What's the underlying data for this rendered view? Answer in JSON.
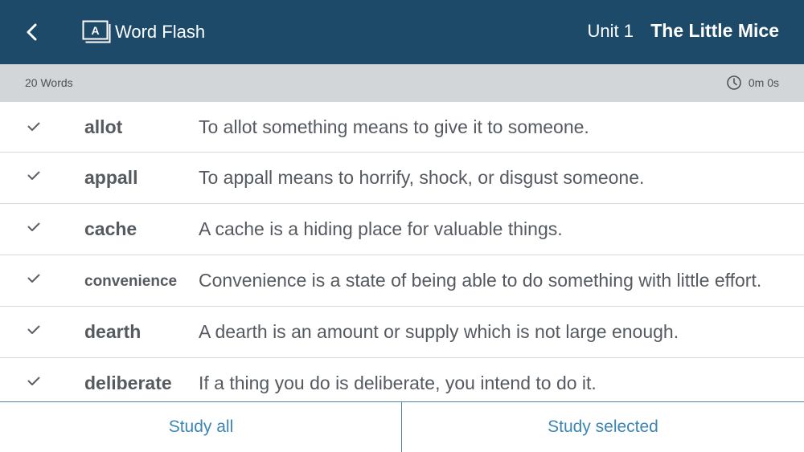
{
  "header": {
    "app_title": "Word Flash",
    "logo_letter": "A",
    "unit": "Unit 1",
    "story_title": "The Little Mice"
  },
  "subbar": {
    "word_count": "20 Words",
    "timer": "0m 0s"
  },
  "words": [
    {
      "word": "allot",
      "definition": "To allot something means to give it to someone."
    },
    {
      "word": "appall",
      "definition": "To appall means to horrify, shock, or disgust someone."
    },
    {
      "word": "cache",
      "definition": "A cache is a hiding place for valuable things."
    },
    {
      "word": "convenience",
      "definition": "Convenience is a state of being able to do something with little effort."
    },
    {
      "word": "dearth",
      "definition": "A dearth is an amount or supply which is not large enough."
    },
    {
      "word": "deliberate",
      "definition": "If a thing you do is deliberate, you intend to do it."
    }
  ],
  "footer": {
    "study_all": "Study all",
    "study_selected": "Study selected"
  },
  "colors": {
    "header_bg": "#1d4a69",
    "subbar_bg": "#d3d6d8",
    "accent": "#3c86b4"
  },
  "icons": {
    "back": "chevron-left-icon",
    "logo": "word-flash-logo-icon",
    "timer": "clock-icon",
    "row_check": "checkmark-icon"
  }
}
